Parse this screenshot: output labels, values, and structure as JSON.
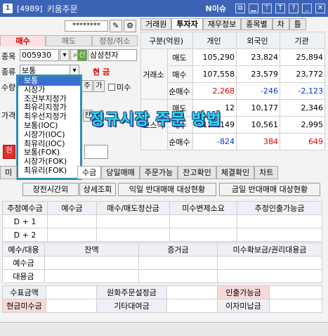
{
  "titlebar": {
    "badge": "1",
    "code": "[4989]",
    "name": "키움주문",
    "news": "N이슈",
    "icons": [
      "copy-icon",
      "minimize-icon",
      "pin-icon",
      "font-icon",
      "help-icon",
      "minimize-window-icon",
      "close-icon"
    ],
    "icon_glyphs": [
      "⧉",
      "▁",
      "⊤",
      "T",
      "?",
      "_",
      "✕"
    ]
  },
  "order": {
    "password": "********",
    "tabs": [
      "매수",
      "매도",
      "정정/취소"
    ],
    "stock_label": "종목",
    "stock_code": "005930",
    "stock_name": "삼성전자",
    "credit_badge": "신",
    "type_label": "종류",
    "type_value": "보통",
    "cash_label": "현 금",
    "qty_label": "수량",
    "qty_btn": "주",
    "avail_btn": "가",
    "not_filled": "미수",
    "price_label": "가격",
    "qty_sub_btn": "잔",
    "buy_button": "현"
  },
  "dropdown": {
    "items": [
      "보통",
      "시장가",
      "조건부지정가",
      "최유리지정가",
      "최우선지정가",
      "보통(IOC)",
      "시장가(IOC)",
      "최유리(IOC)",
      "보통(FOK)",
      "시장가(FOK)",
      "최유리(FOK)"
    ],
    "selected": 0
  },
  "overlay_text": "정규시장 주문 방법",
  "right_tabs": [
    "거래원",
    "투자자",
    "재무정보",
    "종목별",
    "차",
    "틀"
  ],
  "investor": {
    "header": [
      "구분(억원)",
      "개인",
      "외국인",
      "기관"
    ],
    "groups": [
      {
        "name": "거래소",
        "rows": [
          {
            "label": "매도",
            "values": [
              "105,290",
              "23,824",
              "25,894"
            ]
          },
          {
            "label": "매수",
            "values": [
              "107,558",
              "23,579",
              "23,772"
            ]
          },
          {
            "label": "순매수",
            "values": [
              "2,268",
              "-246",
              "-2,123"
            ]
          }
        ]
      },
      {
        "name": "코스닥",
        "rows": [
          {
            "label": "매도",
            "values": [
              "12",
              "10,177",
              "2,346"
            ]
          },
          {
            "label": "매수",
            "values": [
              "122,149",
              "10,561",
              "2,995"
            ]
          },
          {
            "label": "순매수",
            "values": [
              "-824",
              "384",
              "649"
            ]
          }
        ]
      }
    ]
  },
  "bottom_tabs": [
    "미",
    "수금",
    "당일매매",
    "주문가능",
    "잔고확인",
    "체결확인",
    "차트"
  ],
  "sub_buttons": [
    "장전시간외",
    "상세조회",
    "익일 반대매매 대상현황",
    "금일 반대매매 대상현황"
  ],
  "deposit_table": {
    "header": [
      "추정예수금",
      "예수금",
      "매수/매도정산금",
      "미수변제소요",
      "추정인출가능금"
    ],
    "rows": [
      "D + 1",
      "D + 2"
    ]
  },
  "margin_table": {
    "header": [
      "예수/대용",
      "잔액",
      "증거금",
      "미수확보금/권리대용금"
    ],
    "rows": [
      "예수금",
      "대용금"
    ]
  },
  "summary_table": {
    "row1": [
      "수표금액",
      "",
      "원화주문설정금",
      "",
      "인출가능금",
      ""
    ],
    "row2": [
      "현금미수금",
      "",
      "기타대여금",
      "",
      "이자미납금",
      ""
    ]
  }
}
